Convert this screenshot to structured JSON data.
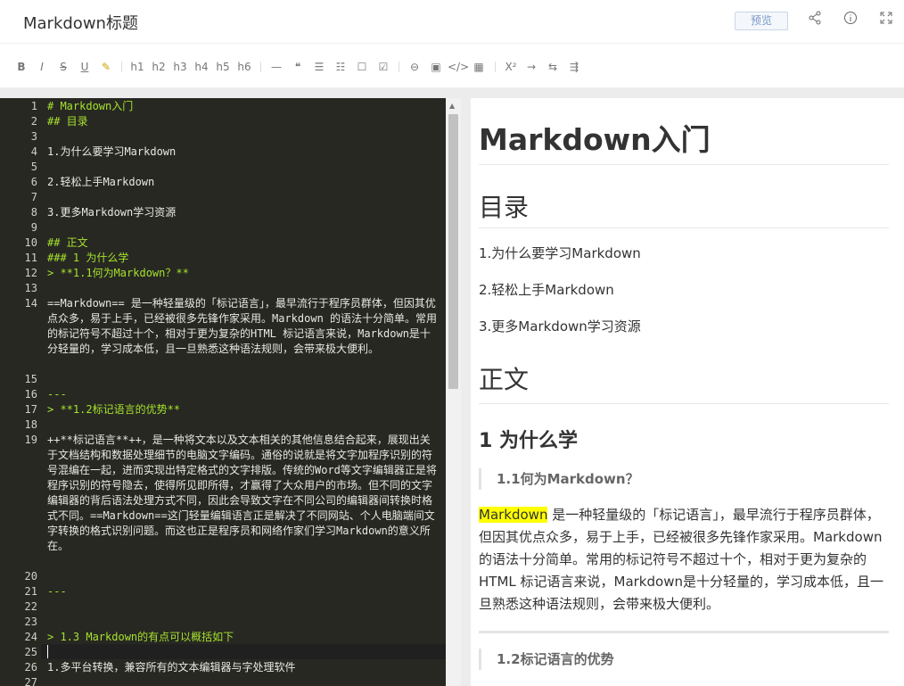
{
  "header": {
    "title": "Markdown标题",
    "preview_label": "预览"
  },
  "toolbar": {
    "format": [
      "B",
      "I",
      "S",
      "U",
      "✎"
    ],
    "headings": [
      "h1",
      "h2",
      "h3",
      "h4",
      "h5",
      "h6"
    ],
    "blocks": [
      "—",
      "❝",
      "☰",
      "☷",
      "☐",
      "☑"
    ],
    "inserts": [
      "⊖",
      "▣",
      "</>",
      "▦"
    ],
    "misc": [
      "X²",
      "→",
      "⇆",
      "⇶"
    ]
  },
  "editor": {
    "lines": [
      {
        "n": "1",
        "text": "# Markdown入门",
        "style": "green"
      },
      {
        "n": "2",
        "text": "## 目录",
        "style": "green"
      },
      {
        "n": "3",
        "text": "",
        "style": ""
      },
      {
        "n": "4",
        "text": "1.为什么要学习Markdown",
        "style": ""
      },
      {
        "n": "5",
        "text": "",
        "style": ""
      },
      {
        "n": "6",
        "text": "2.轻松上手Markdown",
        "style": ""
      },
      {
        "n": "7",
        "text": "",
        "style": ""
      },
      {
        "n": "8",
        "text": "3.更多Markdown学习资源",
        "style": ""
      },
      {
        "n": "9",
        "text": "",
        "style": ""
      },
      {
        "n": "10",
        "text": "## 正文",
        "style": "green"
      },
      {
        "n": "11",
        "text": "### 1 为什么学",
        "style": "green"
      },
      {
        "n": "12",
        "text": "> **1.1何为Markdown？**",
        "style": "green"
      },
      {
        "n": "13",
        "text": "",
        "style": ""
      },
      {
        "n": "14",
        "text": "==Markdown== 是一种轻量级的「标记语言」，最早流行于程序员群体，但因其优点众多，易于上手，已经被很多先锋作家采用。Markdown 的语法十分简单。常用的标记符号不超过十个，相对于更为复杂的HTML 标记语言来说，Markdown是十分轻量的，学习成本低，且一旦熟悉这种语法规则，会带来极大便利。",
        "style": ""
      },
      {
        "n": "15",
        "text": "",
        "style": ""
      },
      {
        "n": "16",
        "text": "---",
        "style": "green"
      },
      {
        "n": "17",
        "text": "> **1.2标记语言的优势**",
        "style": "green"
      },
      {
        "n": "18",
        "text": "",
        "style": ""
      },
      {
        "n": "19",
        "text": "++**标记语言**++，是一种将文本以及文本相关的其他信息结合起来，展现出关于文档结构和数据处理细节的电脑文字编码。通俗的说就是将文字加程序识别的符号混编在一起，进而实现出特定格式的文字排版。传统的Word等文字编辑器正是将程序识别的符号隐去，使得所见即所得，才赢得了大众用户的市场。但不同的文字编辑器的背后语法处理方式不同，因此会导致文字在不同公司的编辑器间转换时格式不同。==Markdown==这门轻量编辑语言正是解决了不同网站、个人电脑端间文字转换的格式识别问题。而这也正是程序员和网络作家们学习Markdown的意义所在。",
        "style": ""
      },
      {
        "n": "20",
        "text": "",
        "style": ""
      },
      {
        "n": "21",
        "text": "---",
        "style": "green"
      },
      {
        "n": "22",
        "text": "",
        "style": ""
      },
      {
        "n": "23",
        "text": "",
        "style": ""
      },
      {
        "n": "24",
        "text": "> 1.3 Markdown的有点可以概括如下",
        "style": "green"
      },
      {
        "n": "25",
        "text": "",
        "style": ""
      },
      {
        "n": "26",
        "text": "1.多平台转换，兼容所有的文本编辑器与字处理软件",
        "style": ""
      },
      {
        "n": "27",
        "text": "",
        "style": ""
      }
    ]
  },
  "preview": {
    "h1": "Markdown入门",
    "toc_title": "目录",
    "toc": [
      "1.为什么要学习Markdown",
      "2.轻松上手Markdown",
      "3.更多Markdown学习资源"
    ],
    "body_title": "正文",
    "section1": "1 为什么学",
    "quote1": "1.1何为Markdown？",
    "para_highlight": "Markdown",
    "para_rest": " 是一种轻量级的「标记语言」，最早流行于程序员群体，但因其优点众多，易于上手，已经被很多先锋作家采用。Markdown 的语法十分简单。常用的标记符号不超过十个，相对于更为复杂的HTML 标记语言来说，Markdown是十分轻量的，学习成本低，且一旦熟悉这种语法规则，会带来极大便利。",
    "quote2": "1.2标记语言的优势"
  }
}
